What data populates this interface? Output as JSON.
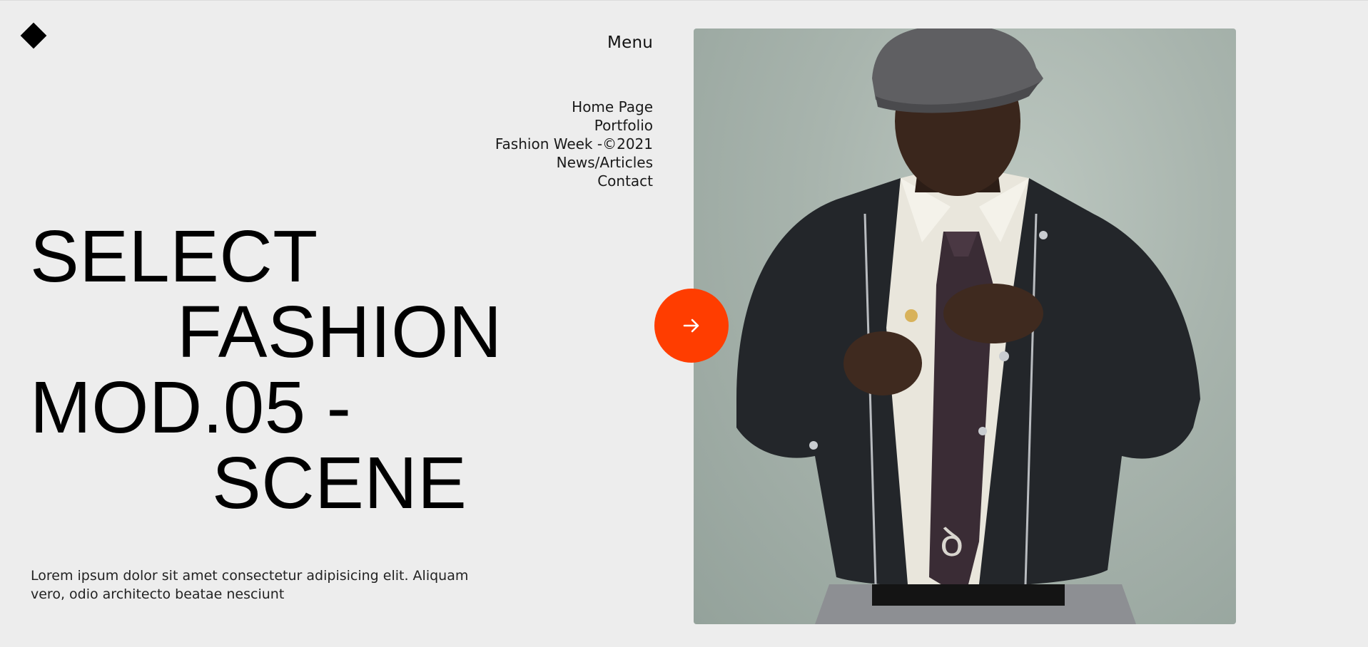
{
  "brand": {
    "logo_icon": "diamond-icon"
  },
  "menu": {
    "title": "Menu",
    "items": [
      {
        "label": "Home Page"
      },
      {
        "label": "Portfolio"
      },
      {
        "label": "Fashion Week -©2021"
      },
      {
        "label": "News/Articles"
      },
      {
        "label": "Contact"
      }
    ]
  },
  "hero": {
    "headline_lines": [
      "SELECT",
      "FASHION",
      "MOD.05 -",
      "SCENE"
    ],
    "description": "Lorem ipsum dolor sit amet consectetur adipisicing elit. Aliquam vero, odio architecto beatae nesciunt",
    "cta_icon": "arrow-right-icon"
  },
  "photo": {
    "subject": "model-adjusting-tie-photo"
  },
  "colors": {
    "background": "#ededed",
    "accent": "#ff3d00",
    "text": "#000000"
  }
}
